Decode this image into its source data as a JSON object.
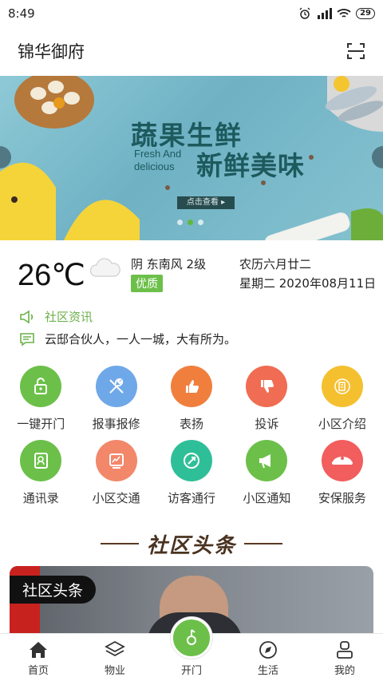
{
  "status_bar": {
    "time": "8:49",
    "battery": "29"
  },
  "header": {
    "title": "锦华御府"
  },
  "banner": {
    "title": "蔬果生鲜",
    "subtitle_en_line1": "Fresh And",
    "subtitle_en_line2": "delicious",
    "subtitle_cn": "新鲜美味",
    "cta": "点击查看 ▸"
  },
  "weather": {
    "temperature": "26℃",
    "description": "阴 东南风  2级",
    "quality": "优质",
    "lunar_date": "农历六月廿二",
    "date": "星期二 2020年08月11日"
  },
  "news": {
    "heading": "社区资讯",
    "text": "云邸合伙人，一人一城，大有所为。"
  },
  "services": [
    {
      "label": "一键开门",
      "color": "#6cc04a",
      "icon": "unlock-icon"
    },
    {
      "label": "报事报修",
      "color": "#6fa8e8",
      "icon": "tools-icon"
    },
    {
      "label": "表扬",
      "color": "#f07f3e",
      "icon": "thumbs-up-icon"
    },
    {
      "label": "投诉",
      "color": "#f06c53",
      "icon": "thumbs-down-icon"
    },
    {
      "label": "小区介绍",
      "color": "#f5c030",
      "icon": "building-icon"
    },
    {
      "label": "通讯录",
      "color": "#6cc04a",
      "icon": "contacts-icon"
    },
    {
      "label": "小区交通",
      "color": "#f2876a",
      "icon": "traffic-icon"
    },
    {
      "label": "访客通行",
      "color": "#2fbf98",
      "icon": "visitor-icon"
    },
    {
      "label": "小区通知",
      "color": "#6cc04a",
      "icon": "megaphone-icon"
    },
    {
      "label": "安保服务",
      "color": "#f25d5d",
      "icon": "security-cap-icon"
    }
  ],
  "section": {
    "title": "社区头条"
  },
  "headline": {
    "tag": "社区头条"
  },
  "nav": {
    "home": "首页",
    "property": "物业",
    "open": "开门",
    "life": "生活",
    "mine": "我的"
  },
  "colors": {
    "accent": "#6cc04a",
    "section_brown": "#4a3320"
  }
}
